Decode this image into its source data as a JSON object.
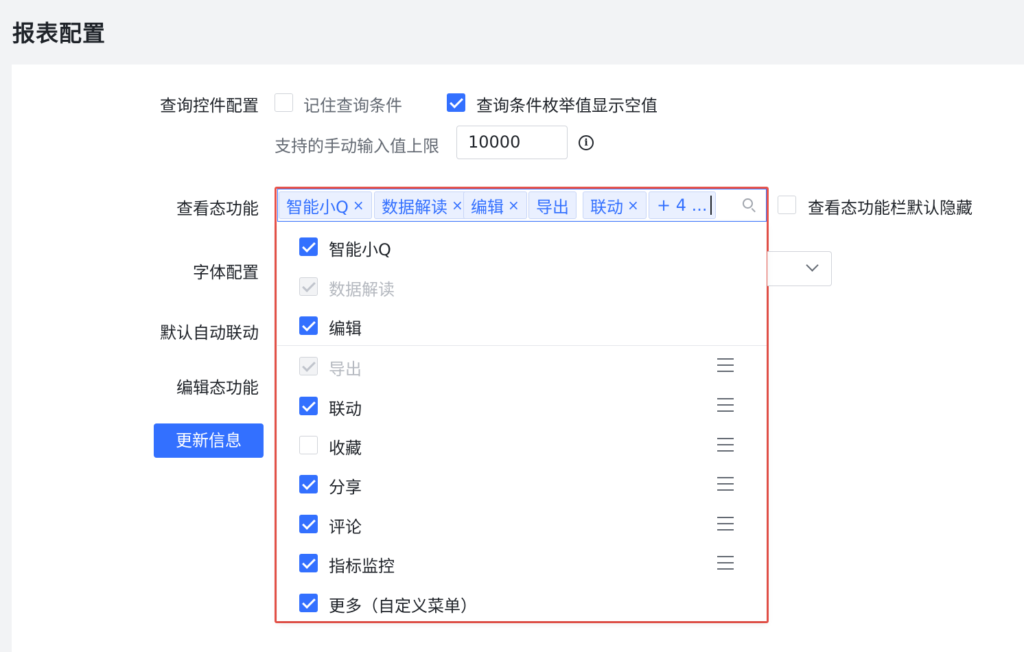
{
  "page": {
    "title": "报表配置"
  },
  "query_config": {
    "label": "查询控件配置",
    "remember_label": "记住查询条件",
    "remember_checked": false,
    "show_empty_label": "查询条件枚举值显示空值",
    "show_empty_checked": true,
    "limit_label": "支持的手动输入值上限",
    "limit_value": "10000",
    "info_icon": "info-icon"
  },
  "view_features": {
    "label": "查看态功能",
    "tags": [
      {
        "label": "智能小Q",
        "closable": true
      },
      {
        "label": "数据解读",
        "closable": true
      },
      {
        "label": "编辑",
        "closable": true
      },
      {
        "label": "导出",
        "closable": false
      },
      {
        "label": "联动",
        "closable": true
      }
    ],
    "more_tag": "+ 4 ...",
    "hide_default_label": "查看态功能栏默认隐藏",
    "hide_default_checked": false
  },
  "dropdown": {
    "options": [
      {
        "label": "智能小Q",
        "state": "checked",
        "draggable": false
      },
      {
        "label": "数据解读",
        "state": "disabled-checked",
        "draggable": false
      },
      {
        "label": "编辑",
        "state": "checked",
        "draggable": false
      },
      {
        "label": "导出",
        "state": "disabled-checked",
        "draggable": true
      },
      {
        "label": "联动",
        "state": "checked",
        "draggable": true
      },
      {
        "label": "收藏",
        "state": "unchecked",
        "draggable": true
      },
      {
        "label": "分享",
        "state": "checked",
        "draggable": true
      },
      {
        "label": "评论",
        "state": "checked",
        "draggable": true
      },
      {
        "label": "指标监控",
        "state": "checked",
        "draggable": true
      },
      {
        "label": "更多（自定义菜单）",
        "state": "checked",
        "draggable": false
      }
    ]
  },
  "font_config": {
    "label": "字体配置"
  },
  "auto_link": {
    "label": "默认自动联动"
  },
  "edit_features": {
    "label": "编辑态功能"
  },
  "update_button": {
    "label": "更新信息"
  },
  "colors": {
    "accent": "#3370ff",
    "highlight_border": "#e8534a"
  }
}
